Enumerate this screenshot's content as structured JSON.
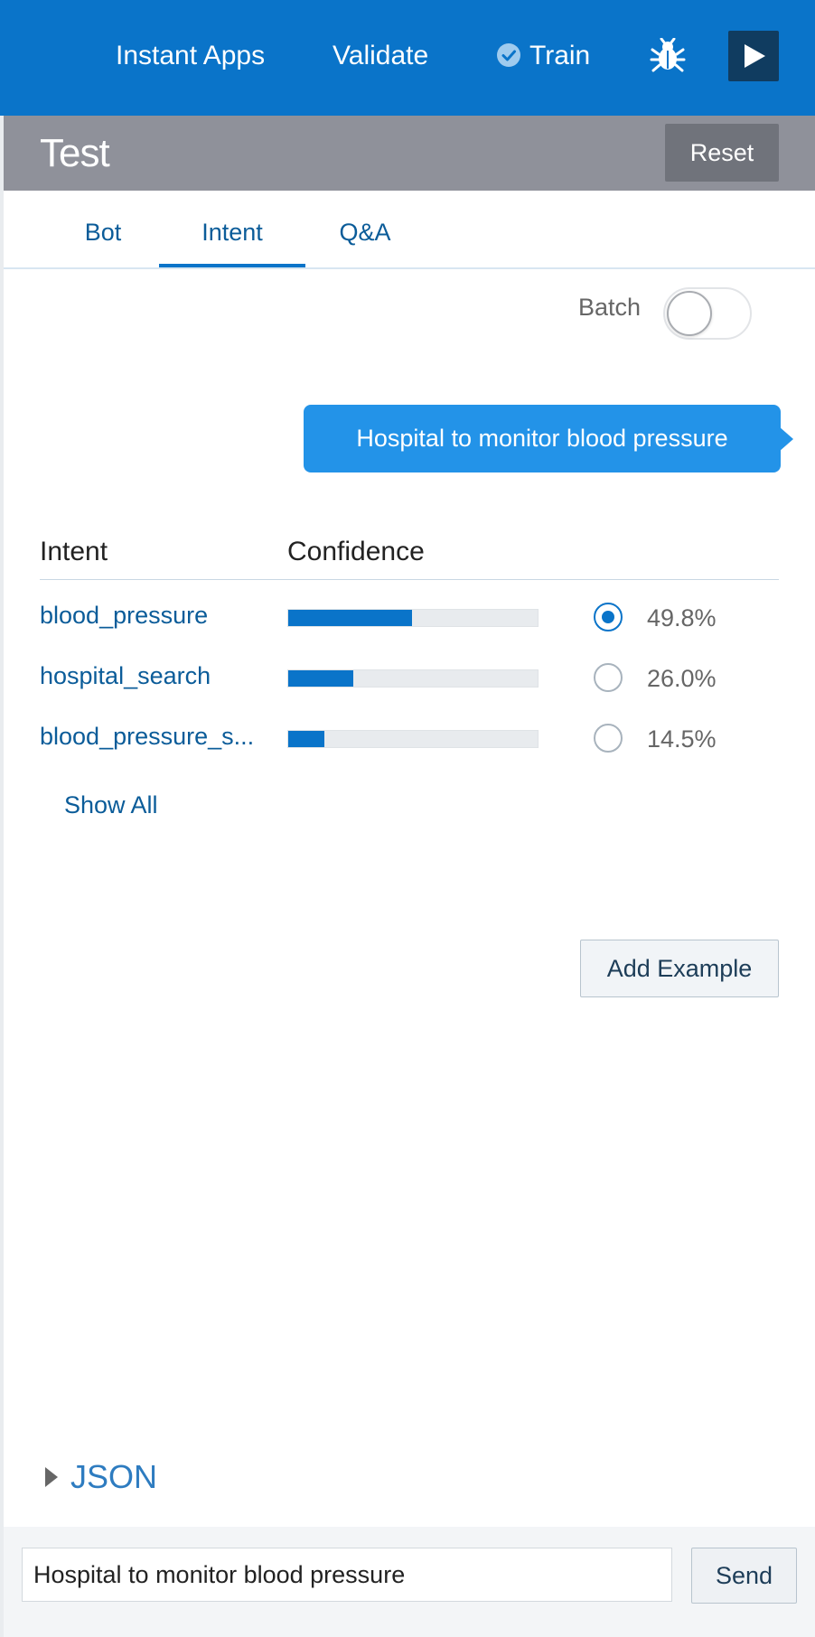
{
  "topbar": {
    "instant_apps": "Instant Apps",
    "validate": "Validate",
    "train": "Train",
    "bug_icon": "bug-icon",
    "play_icon": "play-icon",
    "color": "#0a74c9"
  },
  "test_panel": {
    "title": "Test",
    "reset_label": "Reset"
  },
  "tabs": [
    {
      "label": "Bot",
      "active": false
    },
    {
      "label": "Intent",
      "active": true
    },
    {
      "label": "Q&A",
      "active": false
    }
  ],
  "batch": {
    "label": "Batch",
    "on": false
  },
  "message": "Hospital to monitor blood pressure",
  "table": {
    "headers": {
      "intent": "Intent",
      "confidence": "Confidence"
    },
    "rows": [
      {
        "intent": "blood_pressure",
        "confidence": 0.498,
        "confidence_label": "49.8%",
        "selected": true
      },
      {
        "intent": "hospital_search",
        "confidence": 0.26,
        "confidence_label": "26.0%",
        "selected": false
      },
      {
        "intent": "blood_pressure_s...",
        "confidence": 0.145,
        "confidence_label": "14.5%",
        "selected": false
      }
    ]
  },
  "show_all_label": "Show All",
  "add_example_label": "Add Example",
  "json_label": "JSON",
  "input": {
    "value": "Hospital to monitor blood pressure"
  },
  "send_label": "Send"
}
